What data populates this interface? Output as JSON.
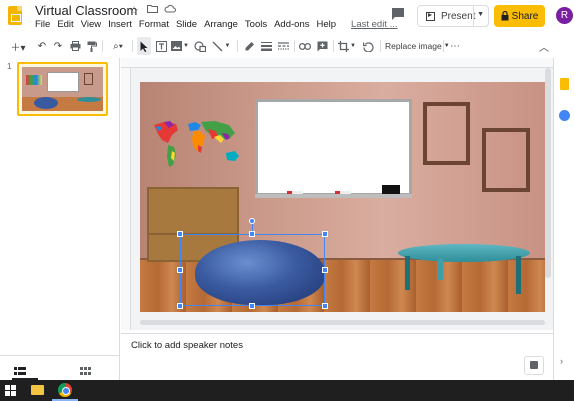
{
  "header": {
    "title": "Virtual Classroom",
    "menu": [
      "File",
      "Edit",
      "View",
      "Insert",
      "Format",
      "Slide",
      "Arrange",
      "Tools",
      "Add-ons",
      "Help"
    ],
    "last_edit": "Last edit ...",
    "present_label": "Present",
    "share_label": "Share",
    "avatar_initial": "R"
  },
  "toolbar": {
    "replace_image_label": "Replace image"
  },
  "filmstrip": {
    "slide_number": "1"
  },
  "notes": {
    "placeholder": "Click to add speaker notes"
  },
  "colors": {
    "accent": "#fbbc04",
    "selection": "#4285f4",
    "avatar": "#7b1fa2"
  },
  "icons": {
    "logo": "slides-logo-icon",
    "star": "star-icon",
    "folder": "folder-icon",
    "cloud": "cloud-icon"
  }
}
